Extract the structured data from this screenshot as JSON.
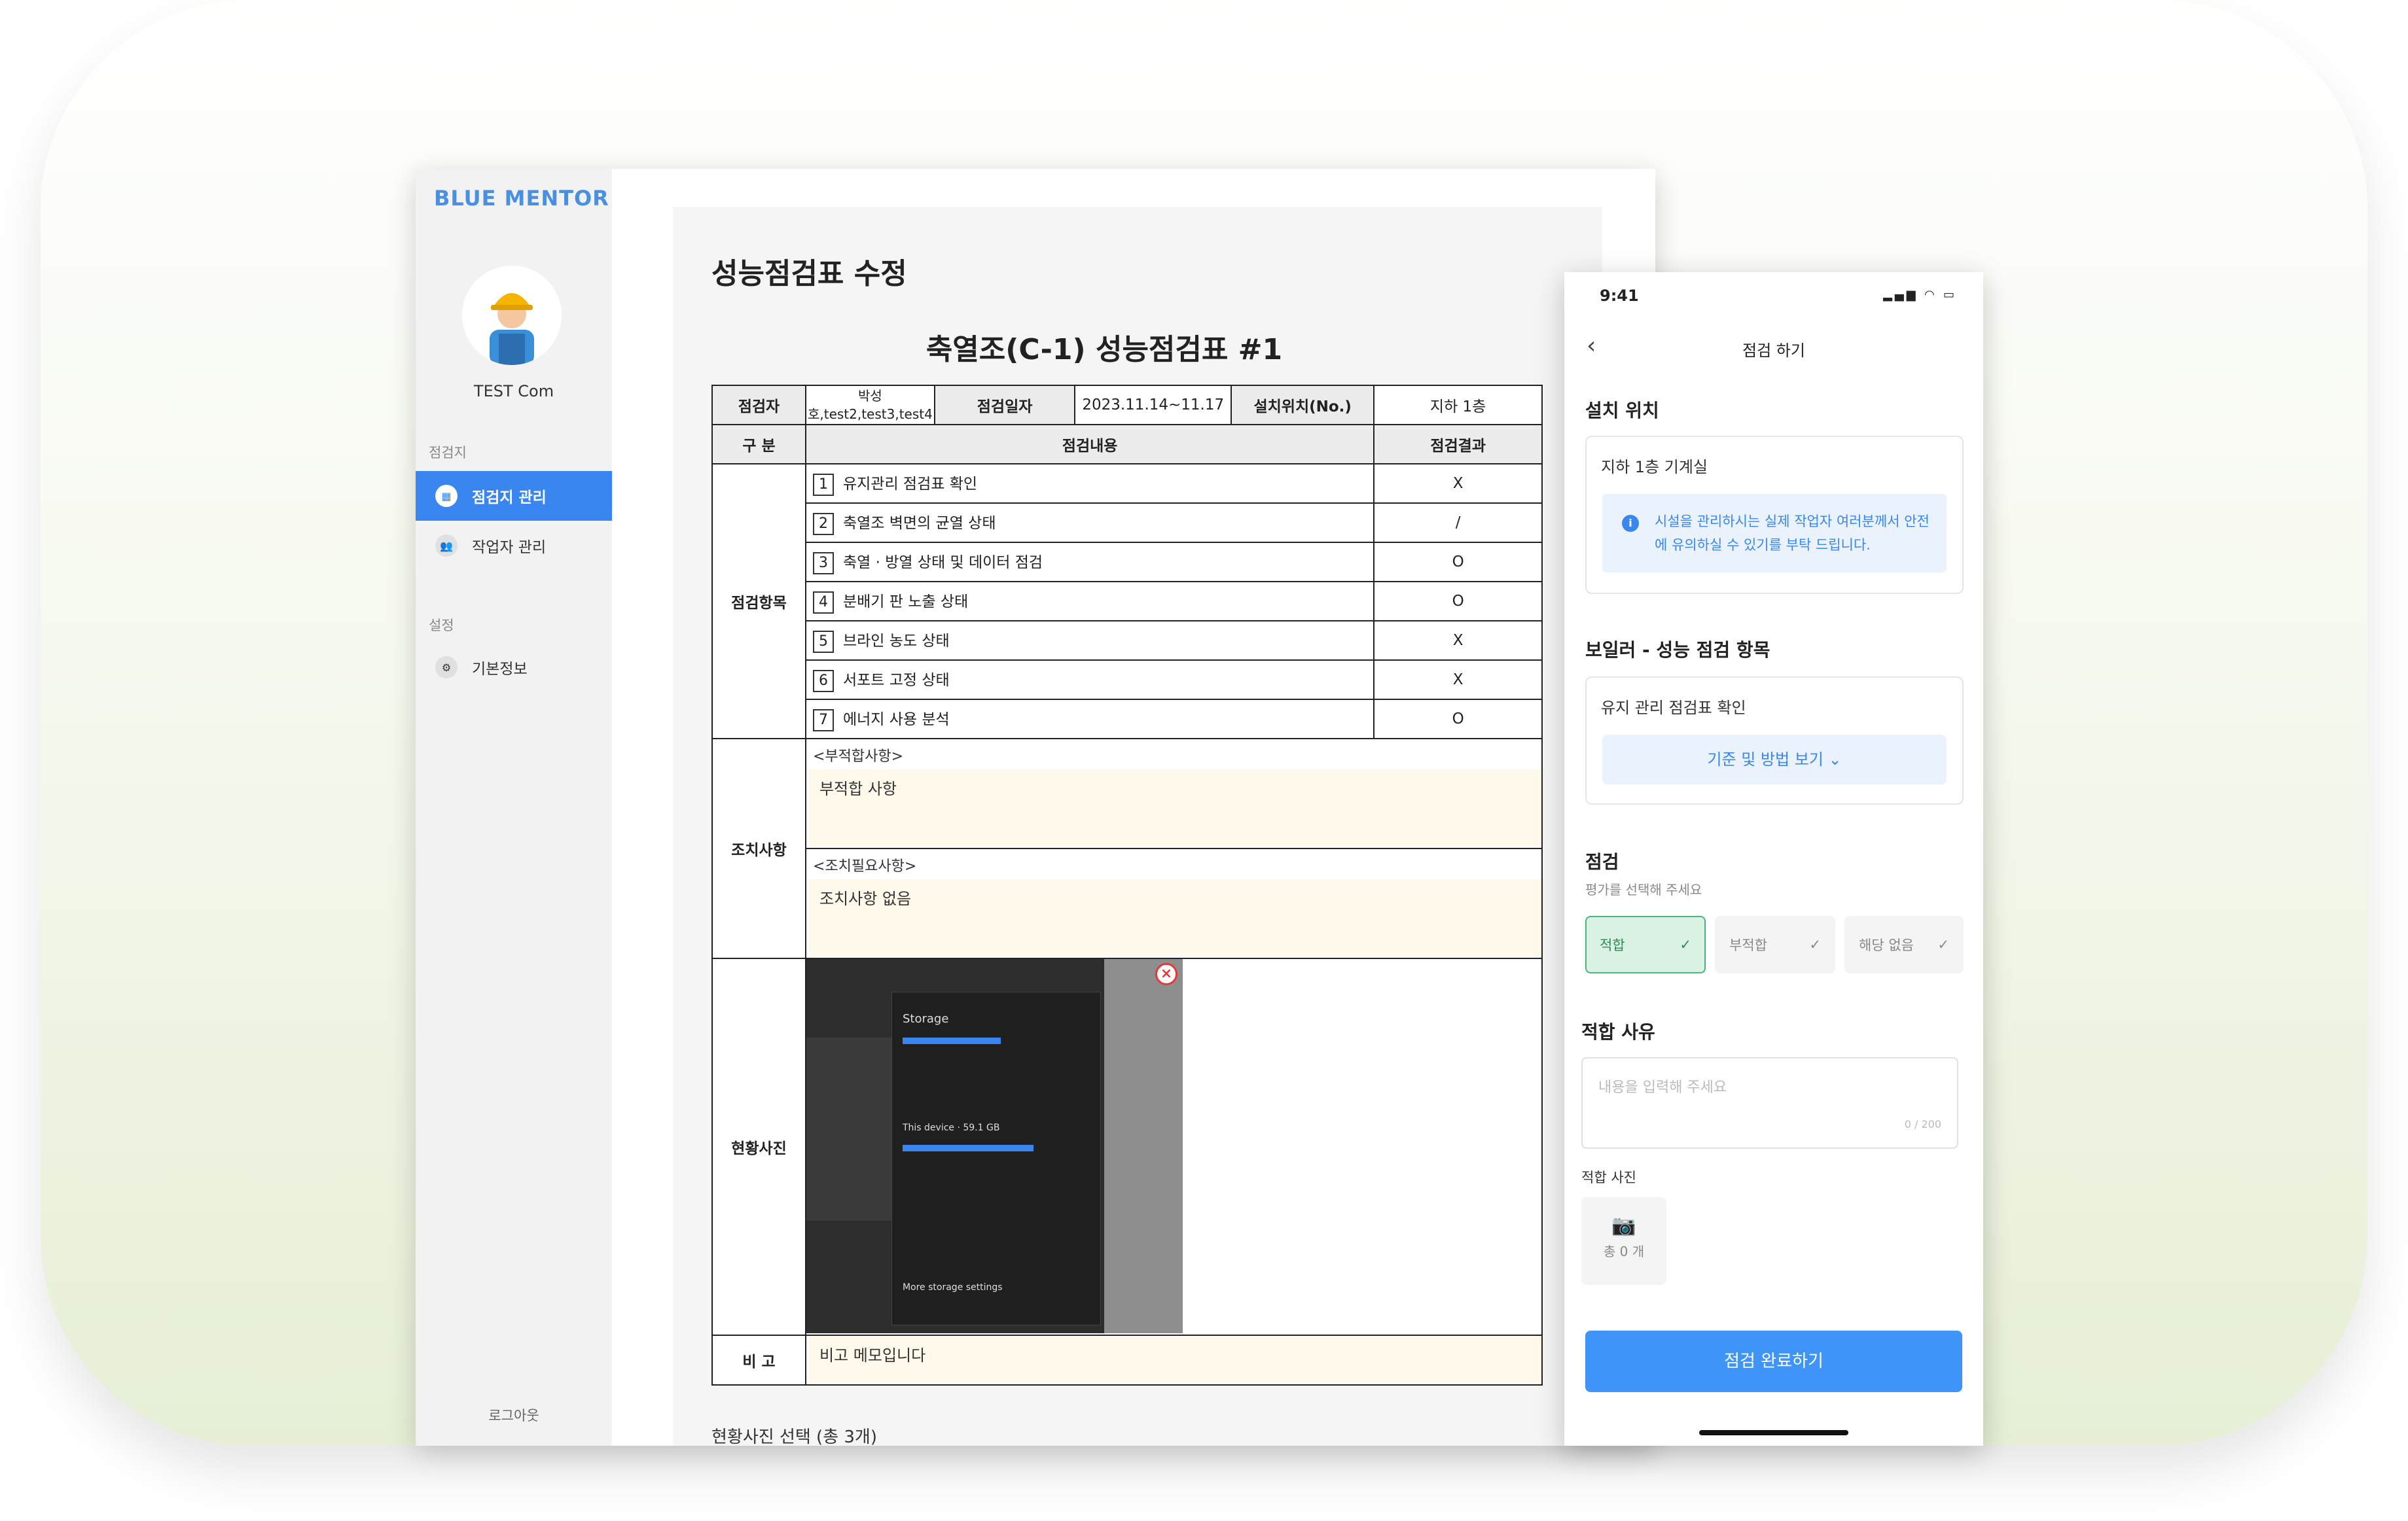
{
  "brand": {
    "logo_text": "BLUE MENTOR",
    "accent": "#3a86f0"
  },
  "sidebar": {
    "company": "TEST Com",
    "section_sites": "점검지",
    "items": [
      {
        "label": "점검지 관리",
        "icon": "dashboard-icon",
        "active": true
      },
      {
        "label": "작업자 관리",
        "icon": "people-icon",
        "active": false
      }
    ],
    "section_settings": "설정",
    "settings_items": [
      {
        "label": "기본정보",
        "icon": "gear-icon"
      }
    ],
    "logout": "로그아웃"
  },
  "main": {
    "page_title": "성능점검표 수정",
    "doc_title": "축열조(C-1) 성능점검표 #1",
    "header": {
      "inspector_label": "점검자",
      "inspector_value_line1": "박성",
      "inspector_value_line2": "호,test2,test3,test4",
      "date_label": "점검일자",
      "date_value": "2023.11.14~11.17",
      "location_label": "설치위치(No.)",
      "location_value": "지하 1층"
    },
    "columns": {
      "category": "구 분",
      "content": "점검내용",
      "result": "점검결과"
    },
    "items_category": "점검항목",
    "items": [
      {
        "no": "1",
        "text": "유지관리 점검표 확인",
        "result": "X"
      },
      {
        "no": "2",
        "text": "축열조 벽면의 균열 상태",
        "result": "/"
      },
      {
        "no": "3",
        "text": "축열 · 방열 상태 및 데이터 점검",
        "result": "O"
      },
      {
        "no": "4",
        "text": "분배기 판 노출 상태",
        "result": "O"
      },
      {
        "no": "5",
        "text": "브라인 농도 상태",
        "result": "X"
      },
      {
        "no": "6",
        "text": "서포트 고정 상태",
        "result": "X"
      },
      {
        "no": "7",
        "text": "에너지 사용 분석",
        "result": "O"
      }
    ],
    "actions_category": "조치사항",
    "nonconform_label": "<부적합사항>",
    "nonconform_value": "부적합 사항",
    "required_label": "<조치필요사항>",
    "required_value": "조치사항 없음",
    "photo_category": "현황사진",
    "photo_panel_title": "Storage",
    "photo_panel_device": "This device · 59.1 GB",
    "photo_panel_more": "More storage settings",
    "remarks_category": "비 고",
    "remarks_value": "비고 메모입니다",
    "photo_select_caption": "현황사진 선택 (총 3개)"
  },
  "phone": {
    "time": "9:41",
    "title": "점검 하기",
    "location_section": "설치 위치",
    "location_value": "지하 1층 기계실",
    "notice": "시설을 관리하시는 실제 작업자 여러분께서 안전에 유의하실 수 있기를 부탁 드립니다.",
    "items_section": "보일러 - 성능 점검 항목",
    "item_title": "유지 관리 점검표 확인",
    "criteria_button": "기준 및 방법 보기 ⌄",
    "check_section": "점검",
    "check_hint": "평가를 선택해 주세요",
    "options": [
      {
        "label": "적합",
        "selected": true
      },
      {
        "label": "부적합",
        "selected": false
      },
      {
        "label": "해당 없음",
        "selected": false
      }
    ],
    "reason_section": "적합 사유",
    "reason_placeholder": "내용을 입력해 주세요",
    "reason_counter": "0 / 200",
    "photo_section": "적합 사진",
    "photo_count": "총 0 개",
    "submit": "점검 완료하기"
  }
}
